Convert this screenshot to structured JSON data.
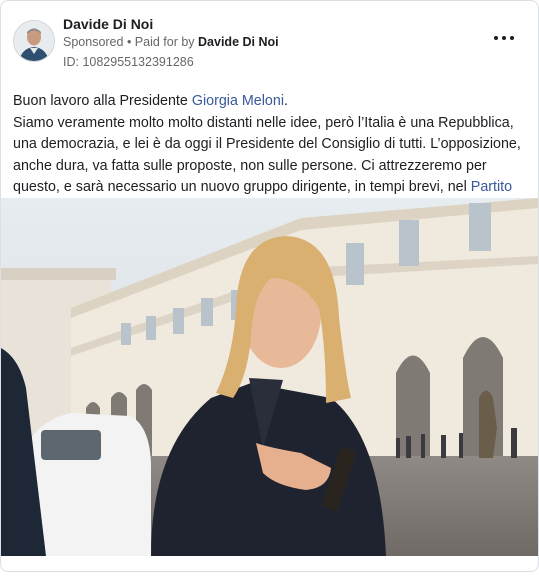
{
  "post": {
    "author": "Davide Di Noi",
    "sponsored": "Sponsored",
    "separator": " • ",
    "paid_for_prefix": "Paid for by ",
    "paid_for_name": "Davide Di Noi",
    "ad_id": "ID: 1082955132391286",
    "text": {
      "line1_prefix": "Buon lavoro alla Presidente ",
      "line1_link": "Giorgia Meloni",
      "line1_suffix": ".",
      "body": "Siamo veramente molto molto distanti nelle idee, però l’Italia è una Repubblica, una democrazia, e lei è da oggi il Presidente del Consiglio di tutti. L’opposizione, anche dura, va fatta sulle proposte, non sulle persone. Ci attrezzeremo per questo, e sarà necessario un nuovo gruppo dirigente, in tempi brevi, nel ",
      "body_link": "Partito Democratico",
      "body_suffix": "."
    },
    "icons": {
      "more": "more-options-icon",
      "avatar": "profile-avatar"
    },
    "colors": {
      "link": "#385898",
      "text": "#1c1e21",
      "muted": "#65676b"
    }
  }
}
